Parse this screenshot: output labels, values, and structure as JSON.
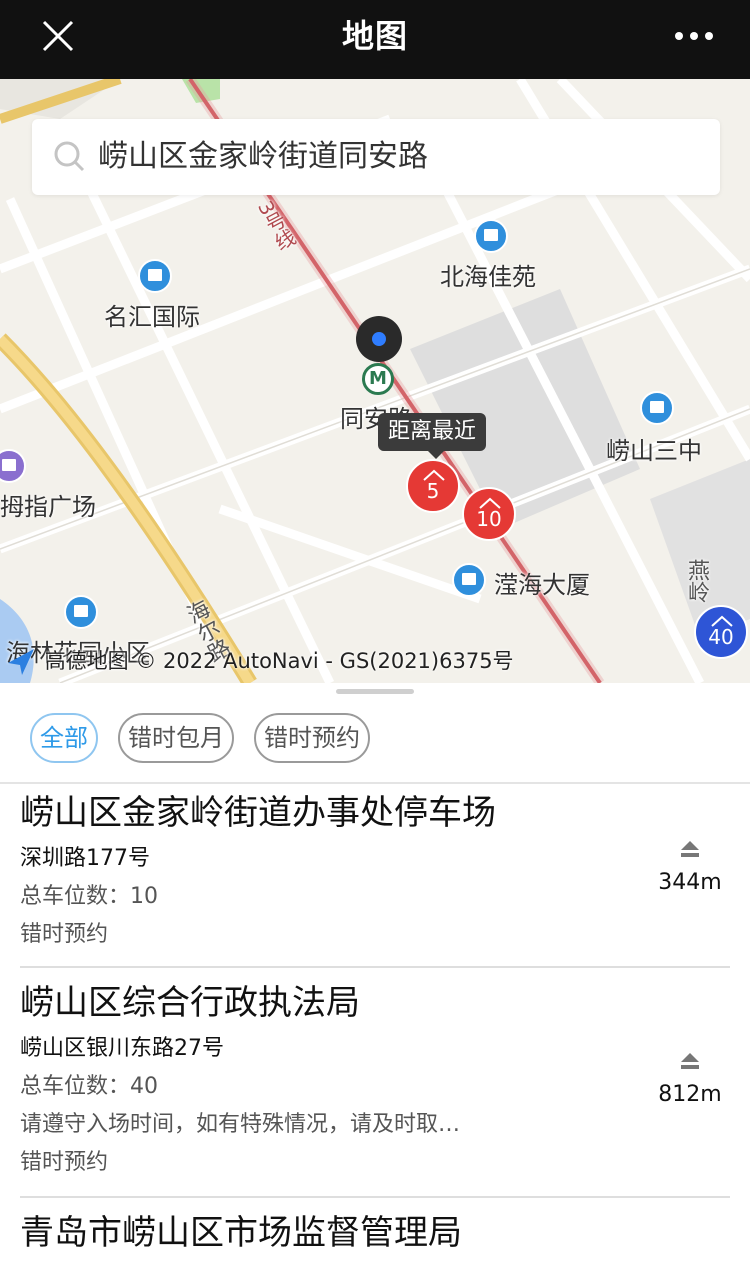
{
  "header": {
    "title": "地图",
    "close_icon": "close-icon",
    "more_icon": "more-icon"
  },
  "search": {
    "value": "崂山区金家岭街道同安路",
    "icon": "search-icon"
  },
  "map": {
    "pois": {
      "beihai": "北海佳苑",
      "minghui": "名汇国际",
      "tongan": "同安路",
      "laoshan3": "崂山三中",
      "muzhi": "拇指广场",
      "yinghai": "滢海大厦",
      "huayuan": "海林花园小区",
      "road_yanling": "燕岭",
      "road_line3": "3号线",
      "road_haier": "海尔路"
    },
    "tooltip": "距离最近",
    "markers": [
      {
        "label": "5",
        "color": "#e53935"
      },
      {
        "label": "10",
        "color": "#e53935"
      },
      {
        "label": "40",
        "color": "#2e55d6"
      }
    ],
    "attribution": "高德地图 © 2022 AutoNavi - GS(2021)6375号"
  },
  "filters": [
    {
      "label": "全部",
      "active": true
    },
    {
      "label": "错时包月",
      "active": false
    },
    {
      "label": "错时预约",
      "active": false
    }
  ],
  "lots": [
    {
      "name": "崂山区金家岭街道办事处停车场",
      "address": "深圳路177号",
      "spaces": "总车位数：10",
      "type": "错时预约",
      "distance": "344m"
    },
    {
      "name": "崂山区综合行政执法局",
      "address": "崂山区银川东路27号",
      "spaces": "总车位数：40",
      "notice": "请遵守入场时间，如有特殊情况，请及时取…",
      "type": "错时预约",
      "distance": "812m"
    },
    {
      "name": "青岛市崂山区市场监督管理局"
    }
  ],
  "colors": {
    "header_bg": "#111111",
    "accent": "#2e9ae8",
    "marker_red": "#e53935",
    "marker_blue": "#2e55d6"
  }
}
